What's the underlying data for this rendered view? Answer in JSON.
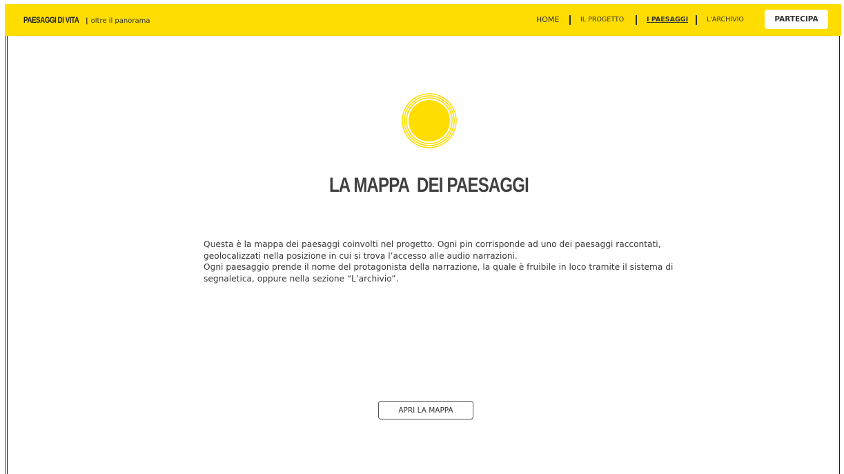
{
  "brand": {
    "name": "PAESAGGI DI VITA",
    "separator": "|",
    "tagline": "oltre il panorama"
  },
  "nav": {
    "items": [
      {
        "label": "HOME"
      },
      {
        "label": "IL PROGETTO"
      },
      {
        "label": "I PAESAGGI",
        "active": true
      },
      {
        "label": "L'ARCHIVIO"
      }
    ],
    "cta_label": "PARTECIPA"
  },
  "hero": {
    "icon": "sun-icon",
    "title": "LA MAPPA  DEI PAESAGGI",
    "paragraphs": [
      "Questa è la mappa dei paesaggi coinvolti nel progetto. Ogni pin corrisponde ad uno dei paesaggi raccontati, geolocalizzati nella posizione in cui si trova l’accesso alle audio narrazioni.",
      "Ogni paesaggio prende il nome del protagonista della narrazione, la quale è fruibile in loco tramite il sistema di segnaletica, oppure nella sezione “L’archivio”."
    ],
    "button_label": "APRI LA MAPPA"
  },
  "colors": {
    "accent": "#ffdd00",
    "text": "#3a3a3a",
    "white": "#ffffff"
  }
}
